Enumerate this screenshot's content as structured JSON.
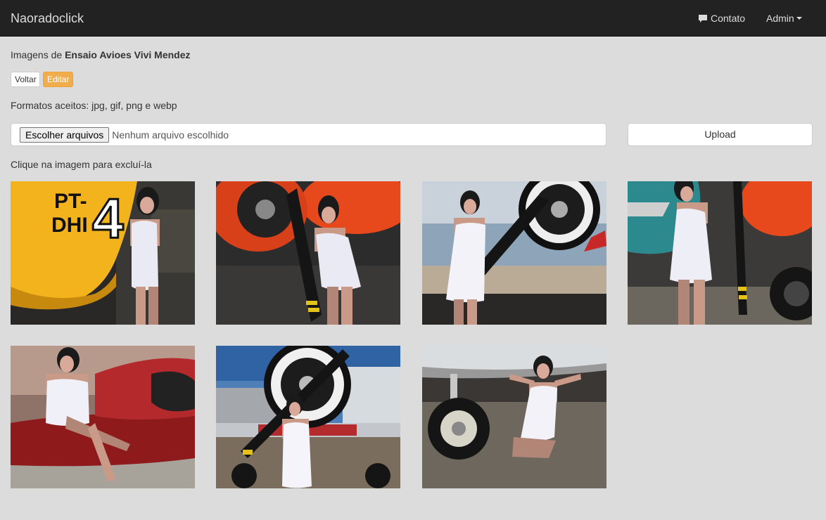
{
  "navbar": {
    "brand": "Naoradoclick",
    "contato_label": "Contato",
    "admin_label": "Admin"
  },
  "page": {
    "heading_prefix": "Imagens de",
    "album_name": "Ensaio Avioes Vivi Mendez",
    "back_button": "Voltar",
    "edit_button": "Editar",
    "formats_text": "Formatos aceitos: jpg, gif, png e webp",
    "file_button": "Escolher arquivos",
    "file_status": "Nenhum arquivo escolhido",
    "upload_button": "Upload",
    "hint_text": "Clique na imagem para excluí-la",
    "photo_labels": {
      "plane_marking_1": "PT-",
      "plane_marking_2": "DHI",
      "plane_number": "4"
    }
  },
  "colors": {
    "navbar_bg": "#222222",
    "page_bg": "#dcdcdc",
    "warning": "#f0ad4e"
  }
}
